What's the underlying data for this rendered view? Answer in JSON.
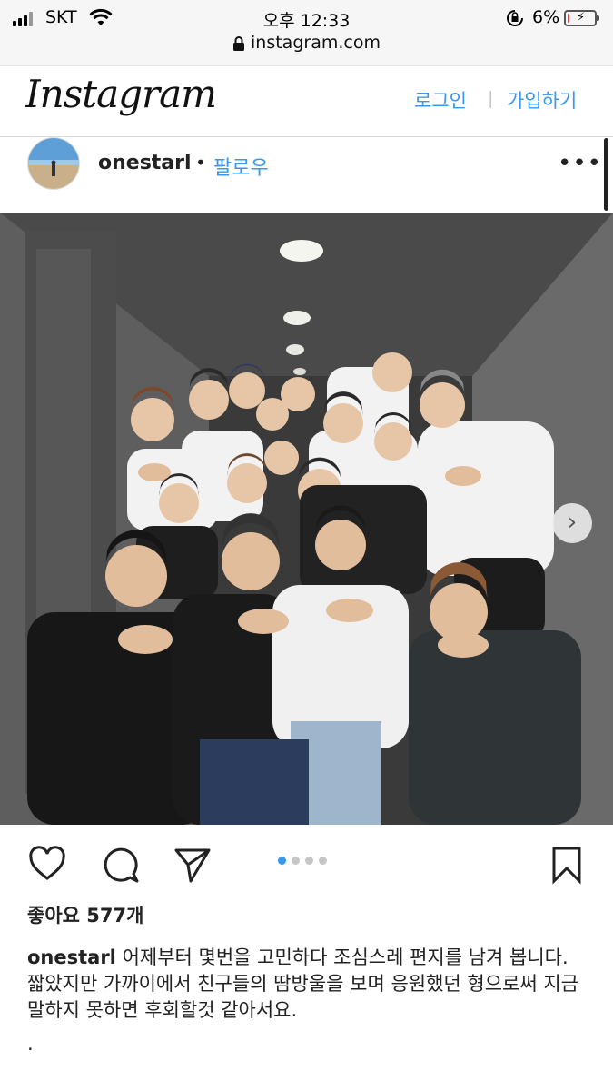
{
  "status_bar": {
    "carrier": "SKT",
    "time": "오후 12:33",
    "battery_percent": "6%",
    "battery_level": 0.06,
    "url": "instagram.com"
  },
  "header": {
    "logo": "Instagram",
    "login_label": "로그인",
    "separator": "|",
    "signup_label": "가입하기"
  },
  "post": {
    "username": "onestarl",
    "bullet": "•",
    "follow_label": "팔로우",
    "more_label": "•••",
    "carousel_total": 4,
    "carousel_active": 1,
    "likes_text": "좋아요 577개",
    "caption_username": "onestarl",
    "caption_line1": "어제부터 몇번을 고민하다 조심스레 편지를 남겨 봅니다.",
    "caption_line2": "짧았지만 가까이에서 친구들의 땀방울을 보며 응원했던 형으로써 지금 말하지 못하면 후회할것 같아서요.",
    "caption_line3": "."
  },
  "icons": {
    "like": "heart-icon",
    "comment": "comment-icon",
    "share": "share-icon",
    "save": "bookmark-icon",
    "next": "chevron-right-icon",
    "secure": "lock-icon"
  },
  "colors": {
    "link_blue": "#3897f0",
    "battery_red": "#e23b3b"
  }
}
